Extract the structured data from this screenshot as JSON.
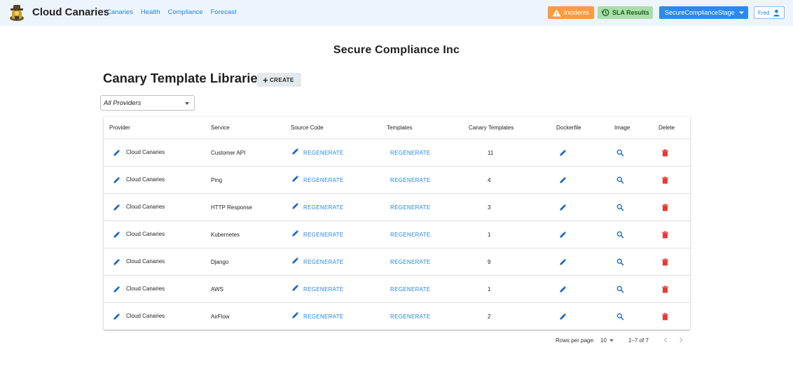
{
  "header": {
    "brand": "Cloud Canaries",
    "nav": [
      "Canaries",
      "Health",
      "Compliance",
      "Forecast"
    ],
    "incidents_label": "Incidents",
    "sla_label": "SLA Results",
    "environment_label": "SecureComplianceStage",
    "user_label": "Fred",
    "colors": {
      "accent": "#1e88e5",
      "incidents": "#fb9b3d",
      "sla": "#a8dfa8",
      "env": "#2b8af0"
    }
  },
  "org_name": "Secure Compliance Inc",
  "page_title": "Canary Template Libraries",
  "create_label": "CREATE",
  "provider_filter": "All Providers",
  "table": {
    "columns": [
      "Provider",
      "Service",
      "Source Code",
      "Templates",
      "Canary Templates",
      "Dockerfile",
      "Image",
      "Delete"
    ],
    "action_label": "REGENERATE",
    "rows": [
      {
        "provider": "Cloud Canaries",
        "service": "Customer API",
        "canary_templates": "11"
      },
      {
        "provider": "Cloud Canaries",
        "service": "Ping",
        "canary_templates": "4"
      },
      {
        "provider": "Cloud Canaries",
        "service": "HTTP Response",
        "canary_templates": "3"
      },
      {
        "provider": "Cloud Canaries",
        "service": "Kubernetes",
        "canary_templates": "1"
      },
      {
        "provider": "Cloud Canaries",
        "service": "Django",
        "canary_templates": "9"
      },
      {
        "provider": "Cloud Canaries",
        "service": "AWS",
        "canary_templates": "1"
      },
      {
        "provider": "Cloud Canaries",
        "service": "AirFlow",
        "canary_templates": "2"
      }
    ]
  },
  "pagination": {
    "rows_per_page_label": "Rows per page:",
    "rows_per_page": "10",
    "range": "1–7 of 7"
  }
}
